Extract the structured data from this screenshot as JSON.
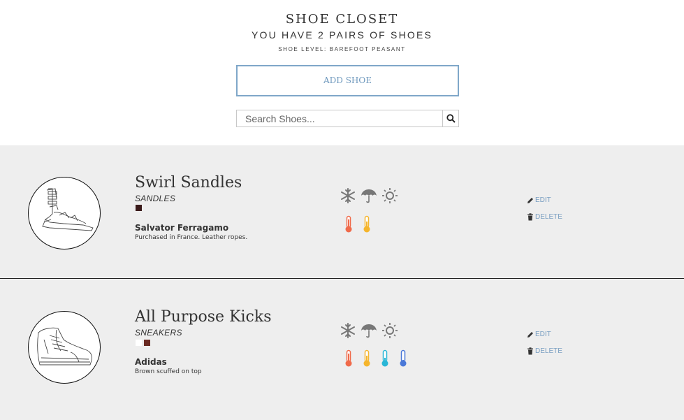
{
  "header": {
    "title": "SHOE CLOSET",
    "subtitle": "YOU HAVE 2 PAIRS OF SHOES",
    "level": "SHOE LEVEL: BAREFOOT PEASANT",
    "add_button": "ADD SHOE",
    "search_placeholder": "Search Shoes..."
  },
  "shoes": [
    {
      "name": "Swirl Sandles",
      "type": "SANDLES",
      "colors": [
        "#3a1a1a"
      ],
      "brand": "Salvator Ferragamo",
      "notes": "Purchased in France. Leather ropes.",
      "weather_icons": [
        "snowflake-icon",
        "umbrella-icon",
        "sun-icon"
      ],
      "temperatures": [
        "hot",
        "warm"
      ],
      "edit_label": "EDIT",
      "delete_label": "DELETE"
    },
    {
      "name": "All Purpose Kicks",
      "type": "SNEAKERS",
      "colors": [
        "#ffffff",
        "#6a2a22"
      ],
      "brand": "Adidas",
      "notes": "Brown scuffed on top",
      "weather_icons": [
        "snowflake-icon",
        "umbrella-icon",
        "sun-icon"
      ],
      "temperatures": [
        "hot",
        "warm",
        "cool",
        "cold"
      ],
      "edit_label": "EDIT",
      "delete_label": "DELETE"
    }
  ],
  "colors": {
    "accent": "#7fa7c9",
    "card_bg": "#eeeeee",
    "temp_hot": "#f06a4a",
    "temp_warm": "#f5b52c",
    "temp_cool": "#29b6d6",
    "temp_cold": "#4a78d8"
  }
}
